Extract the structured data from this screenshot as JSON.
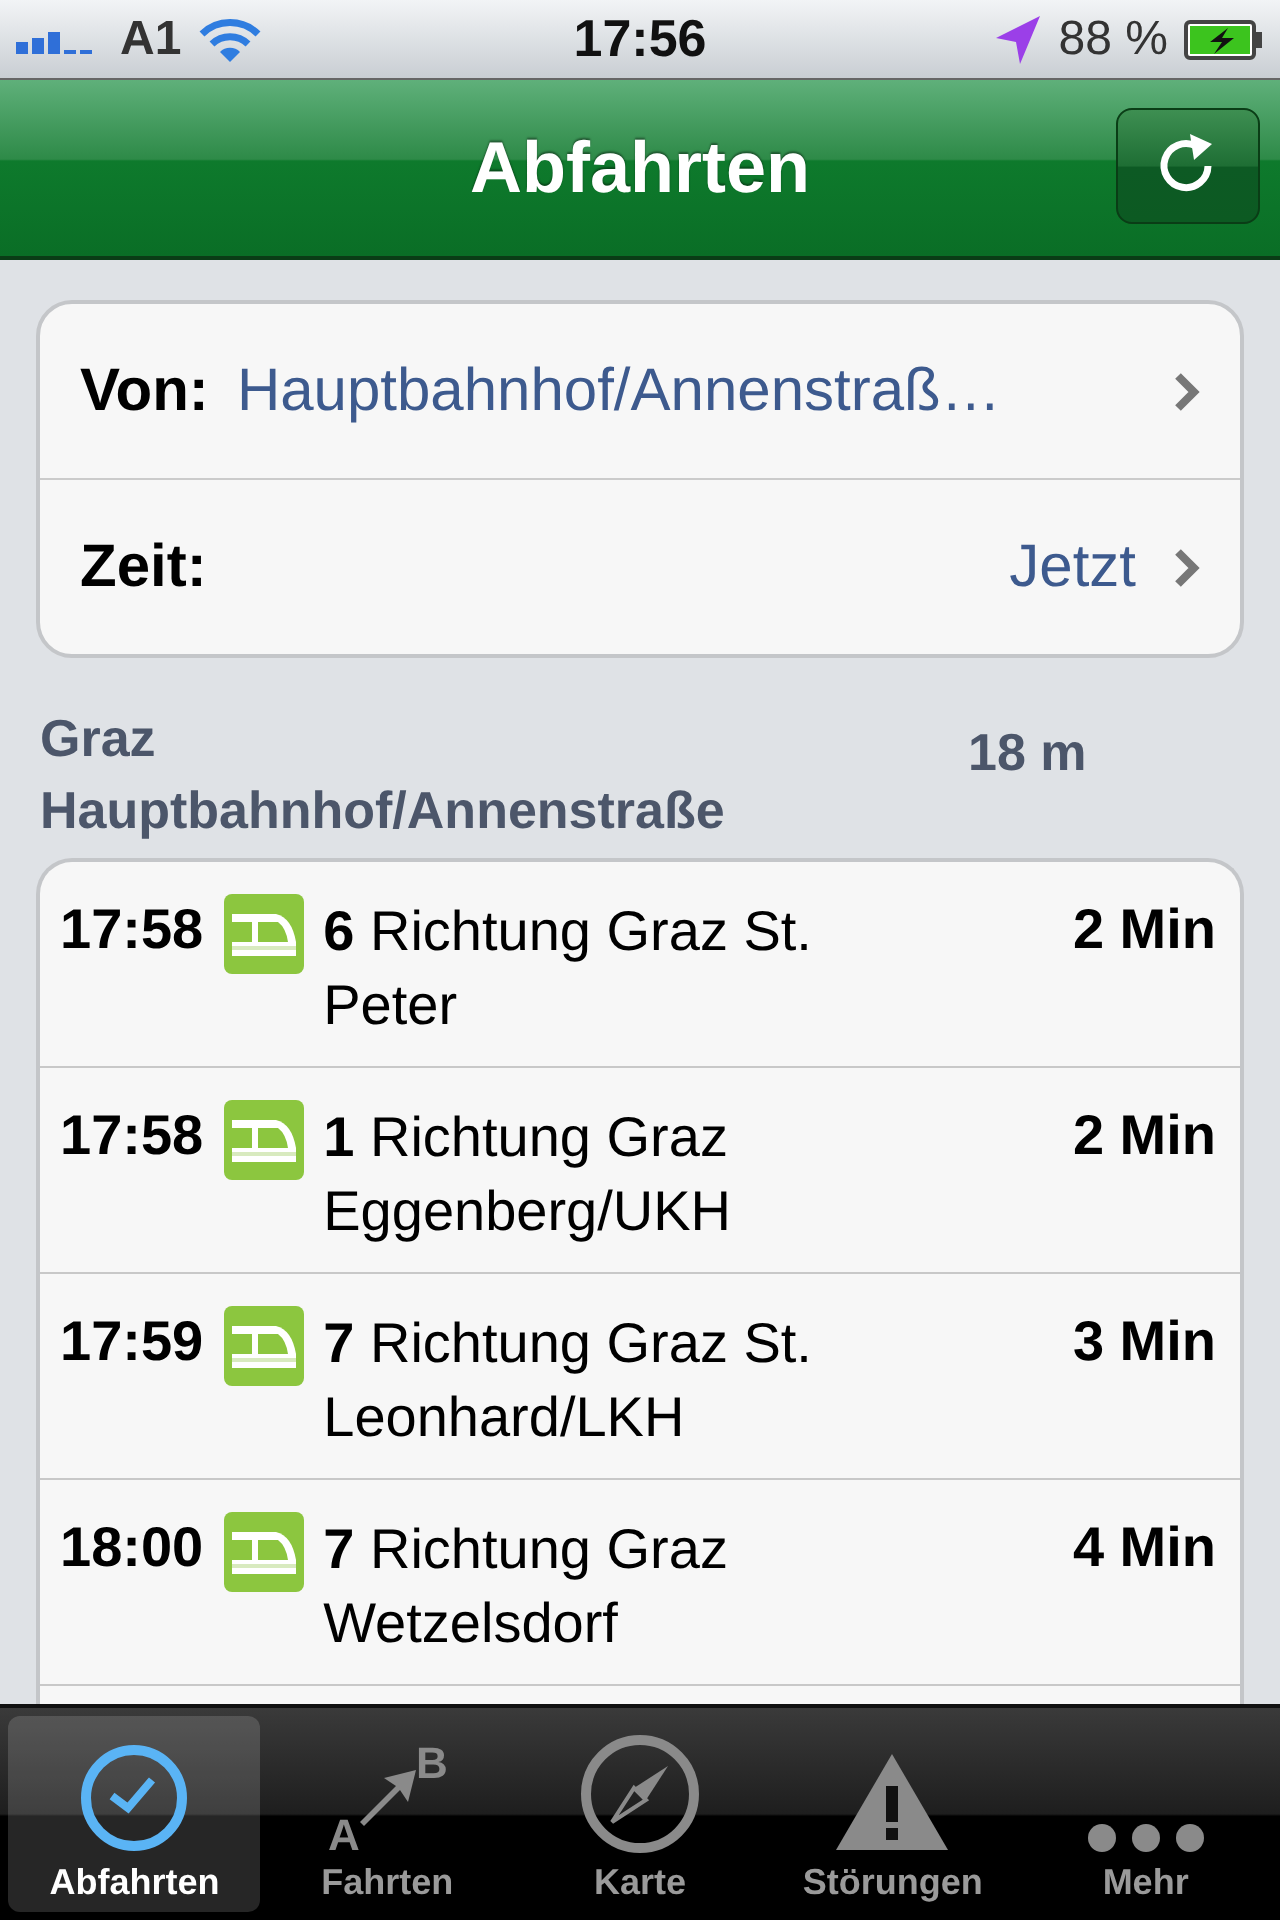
{
  "status_bar": {
    "carrier": "A1",
    "time": "17:56",
    "battery": "88 %"
  },
  "nav": {
    "title": "Abfahrten"
  },
  "form": [
    {
      "label": "Von:",
      "value": "Hauptbahnhof/Annenstraß…",
      "kind": "from"
    },
    {
      "label": "Zeit:",
      "value": "Jetzt",
      "kind": "time"
    }
  ],
  "stop": {
    "name": "Graz Hauptbahnhof/Annenstraße",
    "distance": "18 m"
  },
  "departures": [
    {
      "time": "17:58",
      "line": "6",
      "direction": "Richtung  Graz St. Peter",
      "wait": "2 Min"
    },
    {
      "time": "17:58",
      "line": "1",
      "direction": "Richtung  Graz Eggenberg/UKH",
      "wait": "2 Min"
    },
    {
      "time": "17:59",
      "line": "7",
      "direction": "Richtung  Graz St. Leonhard/LKH",
      "wait": "3 Min"
    },
    {
      "time": "18:00",
      "line": "7",
      "direction": "Richtung  Graz Wetzelsdorf",
      "wait": "4 Min"
    }
  ],
  "tabs": [
    {
      "label": "Abfahrten",
      "kind": "clock",
      "selected": true
    },
    {
      "label": "Fahrten",
      "kind": "route",
      "selected": false,
      "icon_from": "A",
      "icon_to": "B"
    },
    {
      "label": "Karte",
      "kind": "compass",
      "selected": false
    },
    {
      "label": "Störungen",
      "kind": "warning",
      "selected": false
    },
    {
      "label": "Mehr",
      "kind": "more",
      "selected": false
    }
  ]
}
